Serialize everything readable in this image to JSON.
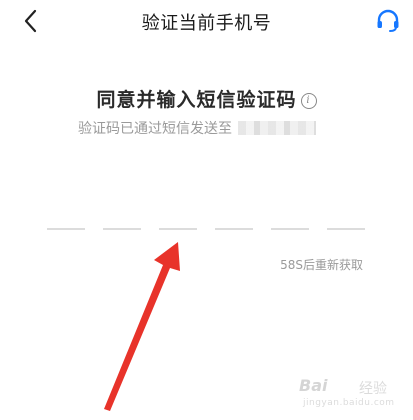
{
  "header": {
    "title": "验证当前手机号",
    "back_icon": "chevron-left-icon",
    "support_icon": "headset-icon",
    "accent_color": "#1677ff"
  },
  "main": {
    "heading": "同意并输入短信验证码",
    "info_icon_glyph": "i",
    "sent_text": "验证码已通过短信发送至",
    "code_slots": [
      "",
      "",
      "",
      "",
      "",
      ""
    ],
    "resend_label": "58S后重新获取"
  },
  "watermark": {
    "brand": "Bai",
    "sub": "经验",
    "url": "jingyan.baidu.com"
  },
  "annotation": {
    "arrow_color": "#e8332a"
  }
}
